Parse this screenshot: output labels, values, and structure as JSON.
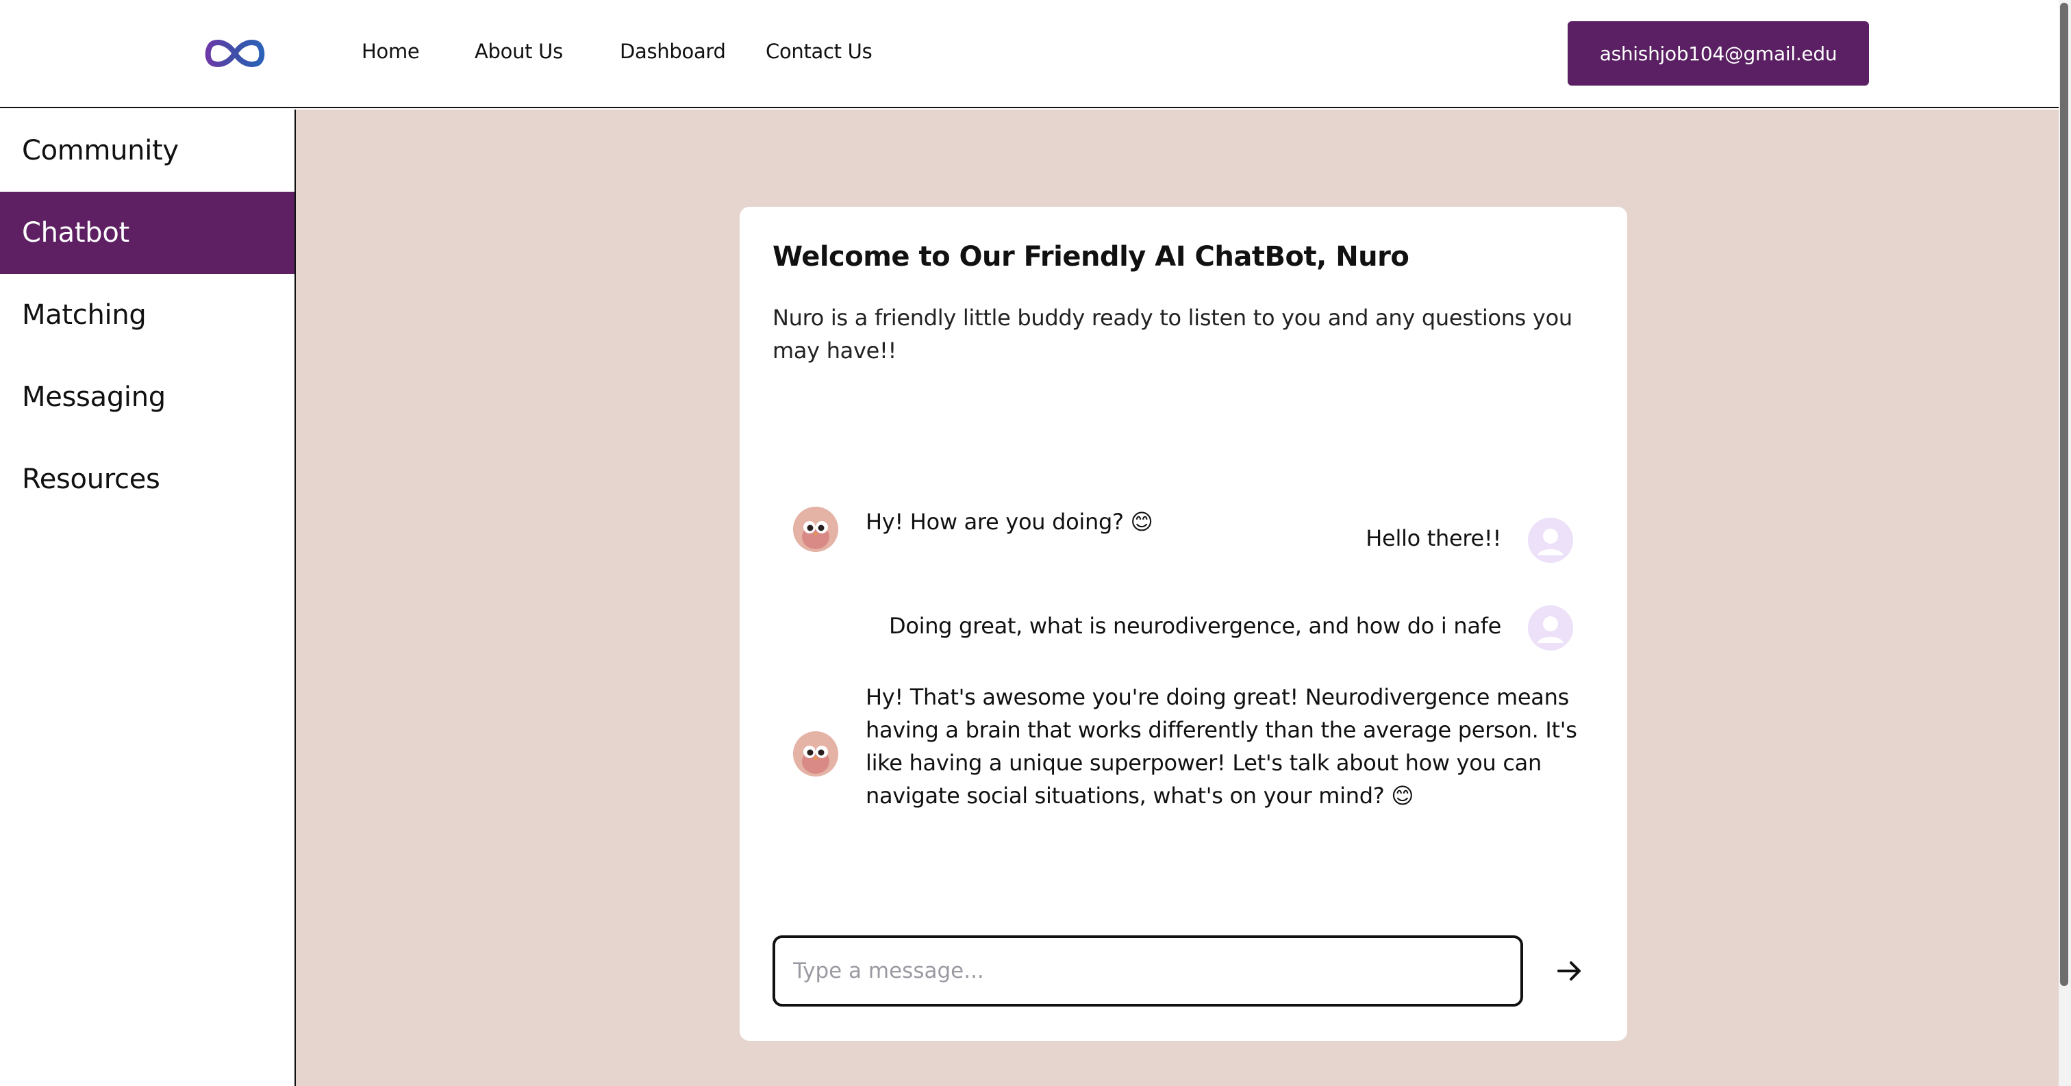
{
  "nav": {
    "logo_icon": "infinity-logo-icon",
    "links": [
      "Home",
      "About Us",
      "Dashboard",
      "Contact Us"
    ],
    "user_email": "ashishjob104@gmail.edu"
  },
  "sidebar": {
    "items": [
      {
        "label": "Community",
        "active": false
      },
      {
        "label": "Chatbot",
        "active": true
      },
      {
        "label": "Matching",
        "active": false
      },
      {
        "label": "Messaging",
        "active": false
      },
      {
        "label": "Resources",
        "active": false
      }
    ]
  },
  "chat": {
    "title": "Welcome to Our Friendly AI ChatBot, Nuro",
    "description": "Nuro is a friendly little buddy ready to listen to you and any questions you may have!!",
    "messages": [
      {
        "sender": "user",
        "text": "Hello there!!"
      },
      {
        "sender": "bot",
        "text": "Hy! How are you doing? 😊"
      },
      {
        "sender": "user",
        "text": "Doing great, what is neurodivergence, and how do i nafe"
      },
      {
        "sender": "bot",
        "text": "Hy! That's awesome you're doing great! Neurodivergence means having a brain that works differently than the average person. It's like having a unique superpower! Let's talk about how you can navigate social situations, what's on your mind? 😊"
      }
    ],
    "input_value": "",
    "input_placeholder": "Type a message...",
    "send_icon": "arrow-right-icon"
  },
  "colors": {
    "brand_purple": "#5e2062",
    "main_background": "#e6d4cf",
    "card_background": "#ffffff",
    "user_avatar_background": "#ece1f8"
  }
}
